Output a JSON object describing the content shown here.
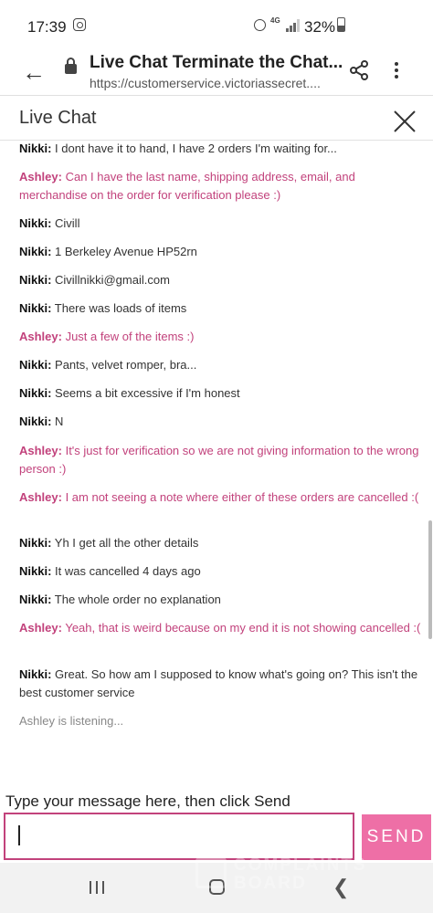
{
  "status_bar": {
    "time": "17:39",
    "network": "4G",
    "battery": "32%"
  },
  "browser": {
    "title": "Live Chat Terminate the Chat...",
    "url": "https://customerservice.victoriassecret...."
  },
  "chat": {
    "header": "Live Chat",
    "messages": [
      {
        "speaker": "Nikki:",
        "text": " I dont have it to hand, I have 2 orders I'm waiting for..."
      },
      {
        "speaker": "Ashley:",
        "text": " Can I have the last name, shipping address, email, and merchandise on the order for verification please :)"
      },
      {
        "speaker": "Nikki:",
        "text": " Civill"
      },
      {
        "speaker": "Nikki:",
        "text": " 1 Berkeley Avenue HP52rn"
      },
      {
        "speaker": "Nikki:",
        "text": " Civillnikki@gmail.com"
      },
      {
        "speaker": "Nikki:",
        "text": " There was loads of items"
      },
      {
        "speaker": "Ashley:",
        "text": " Just a few of the items :)"
      },
      {
        "speaker": "Nikki:",
        "text": " Pants, velvet romper, bra..."
      },
      {
        "speaker": "Nikki:",
        "text": " Seems a bit excessive if I'm honest"
      },
      {
        "speaker": "Nikki:",
        "text": " N"
      },
      {
        "speaker": "Ashley:",
        "text": " It's just for verification so we are not giving information to the wrong person :)"
      },
      {
        "speaker": "Ashley:",
        "text": " I am not seeing a note where either of these orders are cancelled :("
      },
      {
        "speaker": "Nikki:",
        "text": " Yh I get all the other details"
      },
      {
        "speaker": "Nikki:",
        "text": " It was cancelled 4 days ago"
      },
      {
        "speaker": "Nikki:",
        "text": " The whole order no explanation"
      },
      {
        "speaker": "Ashley:",
        "text": " Yeah, that is weird because on my end it is not showing cancelled :("
      },
      {
        "speaker": "Nikki:",
        "text": " Great. So how am I supposed to know what's going on? This isn't the best customer service"
      }
    ],
    "listening": "Ashley is listening...",
    "compose_label": "Type your message here, then click Send",
    "compose_value": "",
    "send_label": "SEND"
  },
  "watermark": {
    "line1": "COMPLAINTS",
    "line2": "BOARD"
  },
  "colors": {
    "agent": "#c2427c",
    "send_button": "#ee6fa6"
  }
}
